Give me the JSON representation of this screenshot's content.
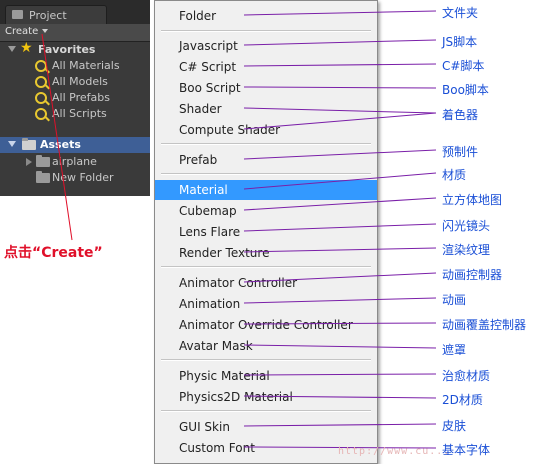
{
  "project_panel": {
    "tab_title": "Project",
    "create_label": "Create",
    "favorites_label": "Favorites",
    "favorites": [
      "All Materials",
      "All Models",
      "All Prefabs",
      "All Scripts"
    ],
    "assets_label": "Assets",
    "assets": [
      "airplane",
      "New Folder"
    ]
  },
  "menu": {
    "selected": "Material",
    "items": [
      "Folder",
      "Javascript",
      "C# Script",
      "Boo Script",
      "Shader",
      "Compute Shader",
      "Prefab",
      "Material",
      "Cubemap",
      "Lens Flare",
      "Render Texture",
      "Animator Controller",
      "Animation",
      "Animator Override Controller",
      "Avatar Mask",
      "Physic Material",
      "Physics2D Material",
      "GUI Skin",
      "Custom Font"
    ]
  },
  "annotations": {
    "labels": [
      "文件夹",
      "JS脚本",
      "C#脚本",
      "Boo脚本",
      "着色器",
      "预制件",
      "材质",
      "立方体地图",
      "闪光镜头",
      "渲染纹理",
      "动画控制器",
      "动画",
      "动画覆盖控制器",
      "遮罩",
      "治愈材质",
      "2D材质",
      "皮肤",
      "基本字体"
    ],
    "click_hint": "点击“Create”",
    "watermark": "http://www.cu..."
  },
  "colors": {
    "selection": "#3399ff",
    "annotation_text": "#1a4fd6",
    "annotation_line": "#7a1fa8",
    "click_hint": "#e0102a"
  }
}
